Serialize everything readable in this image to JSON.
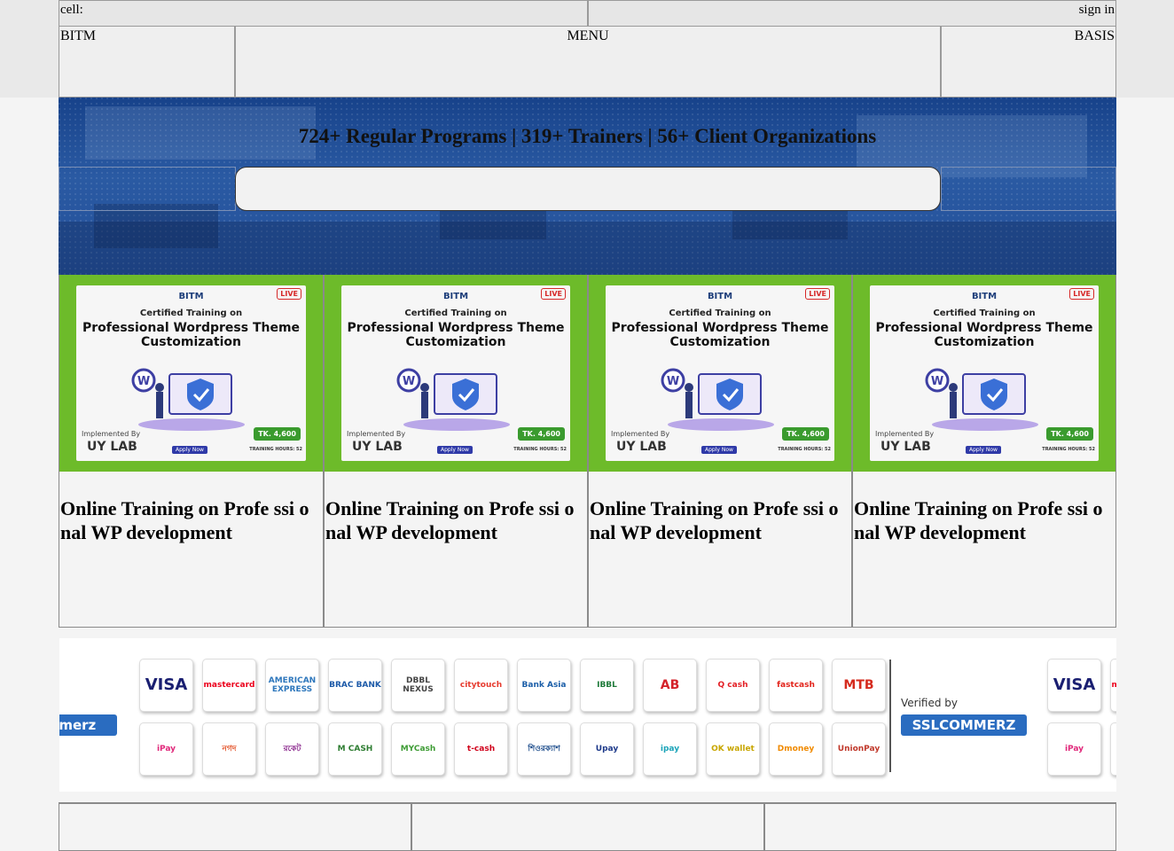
{
  "topbar": {
    "cell_label": "cell:",
    "signin_label": "sign in"
  },
  "navbar": {
    "brand": "BITM",
    "menu_label": "MENU",
    "partner": "BASIS"
  },
  "hero": {
    "stats": "724+ Regular Programs | 319+ Trainers | 56+ Client Organizations",
    "search_placeholder": ""
  },
  "courses": [
    {
      "title": "Online Training on Profe ssi onal WP development"
    },
    {
      "title": "Online Training on Profe ssi onal WP development"
    },
    {
      "title": "Online Training on Profe ssi onal WP development"
    },
    {
      "title": "Online Training on Profe ssi onal WP development"
    }
  ],
  "course_banner": {
    "logo": "BITM",
    "live": "LIVE",
    "certified": "Certified Training on",
    "headline": "Professional Wordpress Theme Customization",
    "implemented_by": "Implemented By",
    "implementer": "UY LAB",
    "apply": "Apply Now",
    "fee": "TK. 4,600",
    "hours": "TRAINING HOURS: 52"
  },
  "payment": {
    "row1": [
      "VISA",
      "mastercard",
      "AMERICAN EXPRESS",
      "BRAC BANK",
      "DBBL NEXUS",
      "citytouch",
      "Bank Asia",
      "IBBL",
      "AB",
      "Q cash",
      "fastcash",
      "MTB"
    ],
    "row2": [
      "iPay",
      "নগদ",
      "রকেট",
      "M CASH",
      "MYCash",
      "t-cash",
      "শিওরক্যাশ",
      "Upay",
      "ipay",
      "OK wallet",
      "Dmoney",
      "UnionPay"
    ],
    "verified_by": "Verified by",
    "sslcommerz": "SSLCOMMERZ",
    "ssl_partial": "mmerz"
  },
  "colors": {
    "hero_blue": "#1d4d93",
    "banner_green": "#6dbb2a",
    "ssl_blue": "#2a6cc0"
  }
}
